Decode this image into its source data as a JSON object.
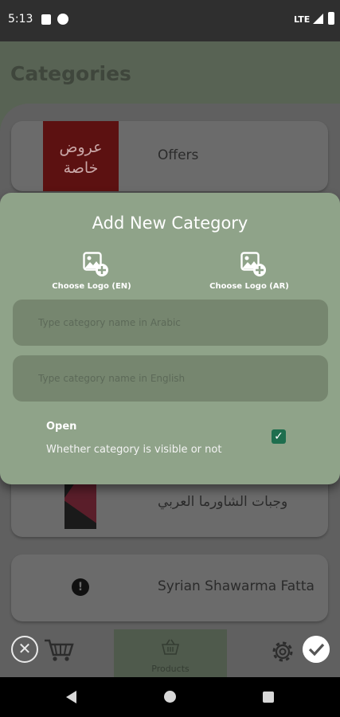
{
  "status_bar": {
    "time": "5:13",
    "network": "LTE"
  },
  "page": {
    "title": "Categories"
  },
  "categories": [
    {
      "name": "Offers",
      "image_text": "عروض خاصة"
    },
    {
      "name": "وجبات الشاورما العربي"
    },
    {
      "name": "Syrian Shawarma Fatta"
    }
  ],
  "dialog": {
    "title": "Add New Category",
    "logo_en_label": "Choose Logo (EN)",
    "logo_ar_label": "Choose Logo (AR)",
    "arabic_name_placeholder": "Type category name in Arabic",
    "english_name_placeholder": "Type category name in English",
    "open_label": "Open",
    "open_description": "Whether category is visible or not",
    "open_checked": true
  },
  "bottom_nav": {
    "products_label": "Products"
  },
  "colors": {
    "dialog_bg": "#8fa389",
    "checkbox": "#1e6e4e"
  }
}
